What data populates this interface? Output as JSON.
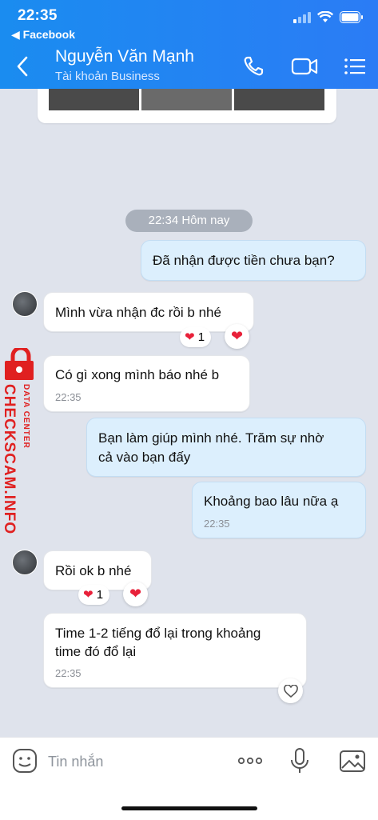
{
  "status_bar": {
    "time": "22:35",
    "back_app": "◀ Facebook"
  },
  "header": {
    "name": "Nguyễn Văn Mạnh",
    "subtitle": "Tài khoản Business"
  },
  "date_separator": "22:34 Hôm nay",
  "watermark": {
    "brand": "CHECKSCAM.INFO",
    "sub": "DATA CENTER"
  },
  "messages": [
    {
      "dir": "out",
      "text": "Đã nhận được tiền chưa bạn?"
    },
    {
      "dir": "in",
      "text": "Mình vừa nhận đc rồi b nhé",
      "reaction_count": "1"
    },
    {
      "dir": "in",
      "text": "Có gì xong mình báo nhé b",
      "time": "22:35"
    },
    {
      "dir": "out",
      "text_line1": "Bạn làm giúp mình nhé. Trăm sự nhờ",
      "text_line2": "cả vào bạn đấy"
    },
    {
      "dir": "out",
      "text": "Khoảng bao lâu nữa ạ",
      "time": "22:35"
    },
    {
      "dir": "in",
      "text": "Rồi ok b nhé",
      "reaction_count": "1"
    },
    {
      "dir": "in",
      "text_line1": "Time 1-2 tiếng đổ lại trong khoảng",
      "text_line2": "time đó đổ lại",
      "time": "22:35"
    }
  ],
  "input": {
    "placeholder": "Tin nhắn"
  },
  "colors": {
    "header": "#1f86f2",
    "chat_bg": "#dfe3ec",
    "out_bubble": "#dceffd",
    "heart": "#e8213a",
    "watermark": "#e02020"
  }
}
